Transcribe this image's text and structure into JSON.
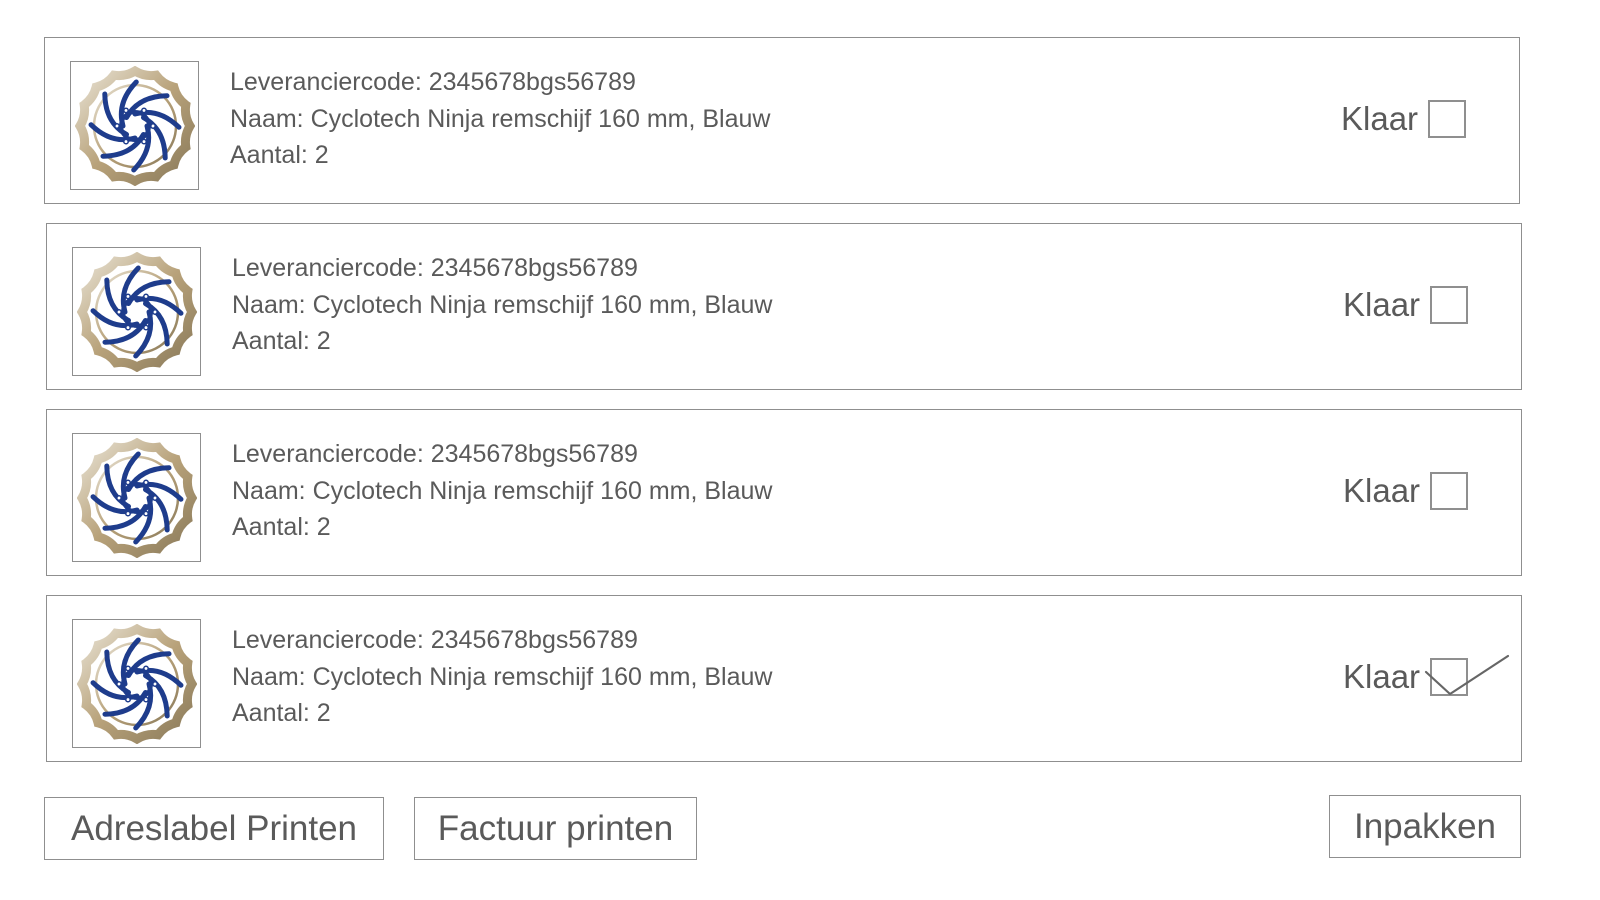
{
  "items": [
    {
      "supplier_code": "Leveranciercode: 2345678bgs56789",
      "name": "Naam: Cyclotech Ninja remschijf 160 mm, Blauw",
      "quantity": "Aantal: 2",
      "done_label": "Klaar",
      "checked": false,
      "image_icon": "brake-disc-icon"
    },
    {
      "supplier_code": "Leveranciercode: 2345678bgs56789",
      "name": "Naam: Cyclotech Ninja remschijf 160 mm, Blauw",
      "quantity": "Aantal: 2",
      "done_label": "Klaar",
      "checked": false,
      "image_icon": "brake-disc-icon"
    },
    {
      "supplier_code": "Leveranciercode: 2345678bgs56789",
      "name": "Naam: Cyclotech Ninja remschijf 160 mm, Blauw",
      "quantity": "Aantal: 2",
      "done_label": "Klaar",
      "checked": false,
      "image_icon": "brake-disc-icon"
    },
    {
      "supplier_code": "Leveranciercode: 2345678bgs56789",
      "name": "Naam: Cyclotech Ninja remschijf 160 mm, Blauw",
      "quantity": "Aantal: 2",
      "done_label": "Klaar",
      "checked": true,
      "image_icon": "brake-disc-icon"
    }
  ],
  "actions": {
    "address_label_button": "Adreslabel Printen",
    "invoice_button": "Factuur printen",
    "pack_button": "Inpakken"
  },
  "colors": {
    "border": "#8f8f8f",
    "text": "#5a5a5a",
    "disc_blue": "#1e3c8c",
    "disc_metal": "#b8a27a"
  }
}
